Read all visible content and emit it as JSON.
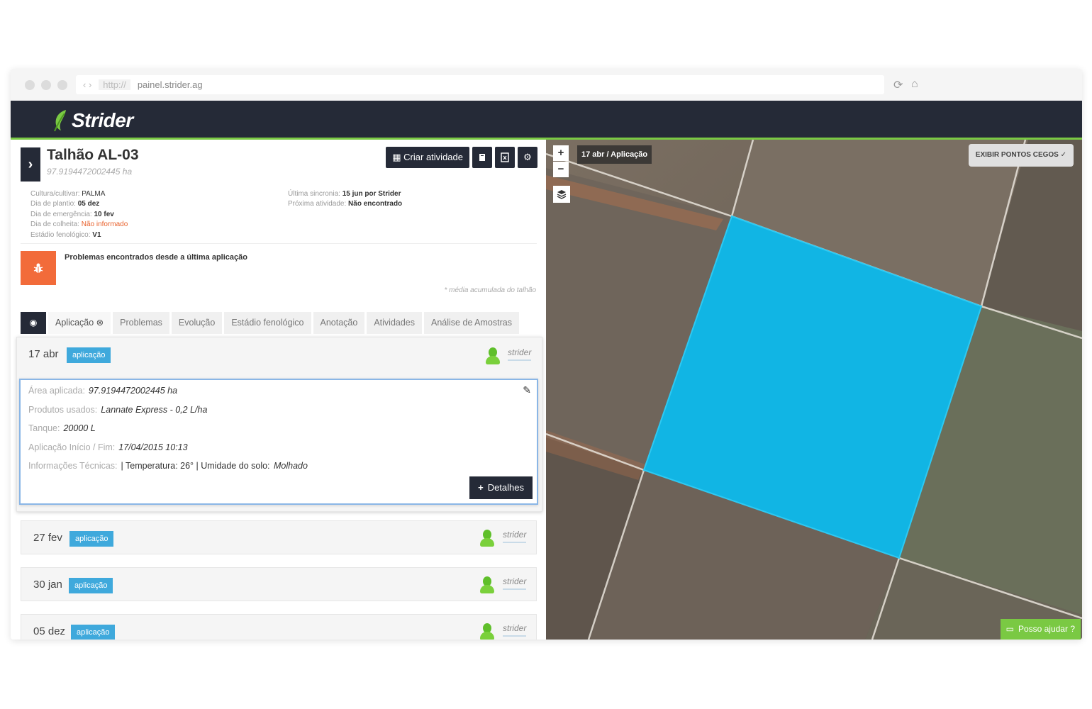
{
  "browser": {
    "nav_glyphs": "‹ ›",
    "protocol": "http://",
    "url": "painel.strider.ag",
    "reload_glyph": "⟳",
    "home_glyph": "⌂"
  },
  "brand": {
    "name": "Strider",
    "accent": "#7ac943",
    "header_bg": "#252a37"
  },
  "field": {
    "title": "Talhão AL-03",
    "area": "97.9194472002445 ha",
    "toggle_glyph": "›"
  },
  "toolbar": {
    "create_label": "Criar atividade",
    "icons": [
      "calendar-icon",
      "notebook-icon",
      "report-icon",
      "gear-icon"
    ]
  },
  "info_left": [
    {
      "label": "Cultura/cultivar:",
      "value": "PALMA",
      "style": "plain"
    },
    {
      "label": "Dia de plantio:",
      "value": "05 dez",
      "style": "bold"
    },
    {
      "label": "Dia de emergência:",
      "value": "10 fev",
      "style": "bold"
    },
    {
      "label": "Dia de colheita:",
      "value": "Não informado",
      "style": "alert"
    },
    {
      "label": "Estádio fenológico:",
      "value": "V1",
      "style": "bold"
    }
  ],
  "info_right": [
    {
      "label": "Última sincronia:",
      "value": "15 jun por Strider"
    },
    {
      "label": "Próxima atividade:",
      "value": "Não encontrado"
    }
  ],
  "problems": {
    "text": "Problemas encontrados desde a última aplicação",
    "note": "* média acumulada do talhão"
  },
  "tabs": [
    {
      "label": "Aplicação ⊗"
    },
    {
      "label": "Problemas"
    },
    {
      "label": "Evolução"
    },
    {
      "label": "Estádio fenológico"
    },
    {
      "label": "Anotação"
    },
    {
      "label": "Atividades"
    },
    {
      "label": "Análise de Amostras"
    }
  ],
  "entries": [
    {
      "date": "17 abr",
      "badge": "aplicação",
      "user": "strider"
    },
    {
      "date": "27 fev",
      "badge": "aplicação",
      "user": "strider"
    },
    {
      "date": "30 jan",
      "badge": "aplicação",
      "user": "strider"
    },
    {
      "date": "05 dez",
      "badge": "aplicação",
      "user": "strider"
    }
  ],
  "detail": {
    "area_label": "Área aplicada:",
    "area_value": "97.9194472002445 ha",
    "products_label": "Produtos usados:",
    "products_value": "Lannate Express - 0,2 L/ha",
    "tank_label": "Tanque:",
    "tank_value": "20000 L",
    "period_label": "Aplicação Início / Fim:",
    "period_value": "17/04/2015 10:13",
    "tech_label": "Informações Técnicas:",
    "tech_value": "| Temperatura: 26° | Umidade do solo:",
    "tech_soil": "Molhado",
    "details_label": "Detalhes"
  },
  "map": {
    "zoom_in": "+",
    "zoom_out": "−",
    "layer_label": "17 abr / Aplicação",
    "blind_spots_label": "EXIBIR PONTOS CEGOS ✓",
    "help_label": "Posso ajudar ?",
    "field_color": "#11b5e4"
  }
}
